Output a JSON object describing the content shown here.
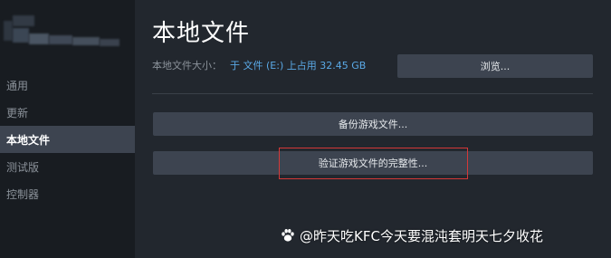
{
  "sidebar": {
    "items": [
      {
        "label": "通用",
        "active": false
      },
      {
        "label": "更新",
        "active": false
      },
      {
        "label": "本地文件",
        "active": true
      },
      {
        "label": "测试版",
        "active": false
      },
      {
        "label": "控制器",
        "active": false
      }
    ]
  },
  "main": {
    "title": "本地文件",
    "size_label": "本地文件大小：",
    "size_value": "于 文件 (E:) 上占用 32.45 GB",
    "browse_label": "浏览...",
    "backup_label": "备份游戏文件...",
    "verify_label": "验证游戏文件的完整性..."
  },
  "watermark": {
    "icon": "paw-icon",
    "text": "@昨天吃KFC今天要混沌套明天七夕收花"
  },
  "colors": {
    "sidebar_bg": "#181c21",
    "main_bg": "#22272e",
    "button_bg": "#3d4450",
    "active_item_bg": "#3d4450",
    "link_blue": "#5aa9e6",
    "highlight_red": "#d43838"
  }
}
